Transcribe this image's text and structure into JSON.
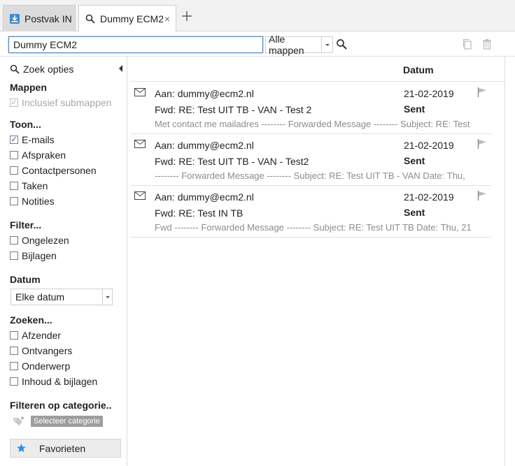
{
  "tabs": [
    {
      "label": "Postvak IN",
      "icon": "inbox-download-icon"
    },
    {
      "label": "Dummy ECM2",
      "icon": "search-icon",
      "close": "×"
    }
  ],
  "search": {
    "value": "Dummy ECM2",
    "folder": "Alle mappen"
  },
  "sidebar": {
    "search_options": "Zoek opties",
    "folders_heading": "Mappen",
    "include_subfolders": "Inclusief submappen",
    "show_heading": "Toon...",
    "show_items": [
      "E-mails",
      "Afspraken",
      "Contactpersonen",
      "Taken",
      "Notities"
    ],
    "filter_heading": "Filter...",
    "filter_items": [
      "Ongelezen",
      "Bijlagen"
    ],
    "date_heading": "Datum",
    "date_value": "Elke datum",
    "search_heading": "Zoeken...",
    "search_items": [
      "Afzender",
      "Ontvangers",
      "Onderwerp",
      "Inhoud & bijlagen"
    ],
    "category_heading": "Filteren op categorie..",
    "category_button": "Selecteer categorie",
    "favorites": "Favorieten"
  },
  "list": {
    "date_header": "Datum",
    "messages": [
      {
        "to": "Aan: dummy@ecm2.nl",
        "date": "21-02-2019",
        "subject": "Fwd: RE: Test UIT TB - VAN - Test 2",
        "status": "Sent",
        "preview": "Met contact me mailadres -------- Forwarded Message -------- Subject: RE: Test"
      },
      {
        "to": "Aan: dummy@ecm2.nl",
        "date": "21-02-2019",
        "subject": "Fwd: RE: Test UIT TB - VAN - Test2",
        "status": "Sent",
        "preview": "-------- Forwarded Message -------- Subject: RE: Test UIT TB - VAN Date: Thu,"
      },
      {
        "to": "Aan: dummy@ecm2.nl",
        "date": "21-02-2019",
        "subject": "Fwd: RE: Test IN TB",
        "status": "Sent",
        "preview": "Fwd -------- Forwarded Message -------- Subject: RE: Test UIT TB Date: Thu, 21"
      }
    ]
  },
  "colors": {
    "accent": "#3b8ad8",
    "star": "#2d8fe3"
  }
}
